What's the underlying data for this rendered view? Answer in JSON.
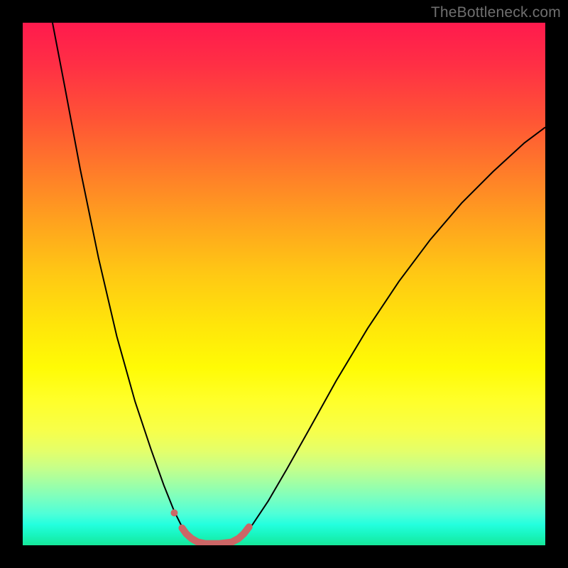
{
  "watermark": "TheBottleneck.com",
  "chart_data": {
    "type": "line",
    "title": "",
    "xlabel": "",
    "ylabel": "",
    "xlim": [
      0,
      100
    ],
    "ylim": [
      0,
      100
    ],
    "background": {
      "style": "vertical-gradient",
      "top_color": "#ff1a4d",
      "mid_color": "#ffe60a",
      "bottom_color": "#16e89a",
      "note": "red→orange→yellow→green gradient from top to bottom representing bottleneck severity"
    },
    "series": [
      {
        "name": "bottleneck-curve",
        "stroke": "#000000",
        "stroke_width": 2,
        "points": [
          {
            "x": 5.7,
            "y": 100.0
          },
          {
            "x": 8.0,
            "y": 88.0
          },
          {
            "x": 11.0,
            "y": 72.0
          },
          {
            "x": 14.5,
            "y": 55.0
          },
          {
            "x": 18.0,
            "y": 40.0
          },
          {
            "x": 21.5,
            "y": 27.5
          },
          {
            "x": 24.5,
            "y": 18.5
          },
          {
            "x": 27.0,
            "y": 11.5
          },
          {
            "x": 29.0,
            "y": 6.5
          },
          {
            "x": 30.5,
            "y": 3.5
          },
          {
            "x": 32.0,
            "y": 1.8
          },
          {
            "x": 33.5,
            "y": 0.6
          },
          {
            "x": 35.0,
            "y": 0.2
          },
          {
            "x": 37.5,
            "y": 0.2
          },
          {
            "x": 40.0,
            "y": 0.6
          },
          {
            "x": 42.0,
            "y": 1.8
          },
          {
            "x": 44.0,
            "y": 4.0
          },
          {
            "x": 47.0,
            "y": 8.5
          },
          {
            "x": 50.5,
            "y": 14.5
          },
          {
            "x": 55.0,
            "y": 22.5
          },
          {
            "x": 60.0,
            "y": 31.5
          },
          {
            "x": 66.0,
            "y": 41.5
          },
          {
            "x": 72.0,
            "y": 50.5
          },
          {
            "x": 78.0,
            "y": 58.5
          },
          {
            "x": 84.0,
            "y": 65.5
          },
          {
            "x": 90.0,
            "y": 71.5
          },
          {
            "x": 96.0,
            "y": 77.0
          },
          {
            "x": 100.0,
            "y": 80.0
          }
        ]
      },
      {
        "name": "threshold-marker",
        "stroke": "#cc6666",
        "stroke_width": 10,
        "stroke_linecap": "round",
        "points": [
          {
            "x": 30.5,
            "y": 3.3
          },
          {
            "x": 31.3,
            "y": 2.2
          },
          {
            "x": 32.3,
            "y": 1.3
          },
          {
            "x": 33.5,
            "y": 0.6
          },
          {
            "x": 35.0,
            "y": 0.3
          },
          {
            "x": 37.5,
            "y": 0.3
          },
          {
            "x": 40.0,
            "y": 0.6
          },
          {
            "x": 41.3,
            "y": 1.3
          },
          {
            "x": 42.3,
            "y": 2.2
          },
          {
            "x": 43.3,
            "y": 3.5
          }
        ]
      },
      {
        "name": "threshold-dot",
        "type": "point",
        "fill": "#cc6666",
        "radius": 5,
        "x": 29.0,
        "y": 6.2
      }
    ]
  }
}
